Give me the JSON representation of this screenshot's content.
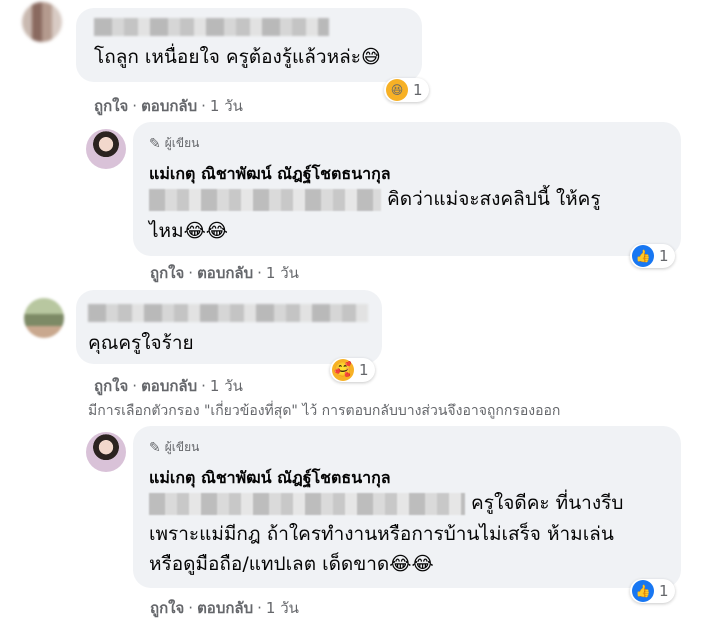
{
  "comments": [
    {
      "text": "โถลูก เหนื่อยใจ ครูต้องรู้แล้วหล่ะ",
      "emoji": "😅",
      "reaction": {
        "icon": "haha-reaction-icon",
        "glyph": "😆",
        "count": "1"
      },
      "like": "ถูกใจ",
      "reply": "ตอบกลับ",
      "time": "1 วัน"
    },
    {
      "author_badge": "ผู้เขียน",
      "author_name": "แม่เกตุ ณิชาพัฒน์ ณัฎฐ์โชตธนากุล",
      "text_line1": "คิดว่าแม่จะสงคลิปนี้ ให้ครู",
      "text_line2": "ไหม",
      "emoji": "😂😂",
      "reaction": {
        "icon": "like-reaction-icon",
        "glyph": "👍",
        "count": "1"
      },
      "like": "ถูกใจ",
      "reply": "ตอบกลับ",
      "time": "1 วัน"
    },
    {
      "text": "คุณครูใจร้าย",
      "reaction": {
        "icon": "care-reaction-icon",
        "glyph": "🥰",
        "count": "1"
      },
      "like": "ถูกใจ",
      "reply": "ตอบกลับ",
      "time": "1 วัน"
    },
    {
      "author_badge": "ผู้เขียน",
      "author_name": "แม่เกตุ ณิชาพัฒน์ ณัฎฐ์โชตธนากุล",
      "text_line1": "ครูใจดีคะ ที่นางรีบ",
      "text_line2": "เพราะแม่มีกฎ ถ้าใครทำงานหรือการบ้านไม่เสร็จ ห้ามเล่น",
      "text_line3": "หรือดูมือถือ/แทปเลต เด็ดขาด",
      "emoji": "😂😂",
      "reaction": {
        "icon": "like-reaction-icon",
        "glyph": "👍",
        "count": "1"
      },
      "like": "ถูกใจ",
      "reply": "ตอบกลับ",
      "time": "1 วัน"
    }
  ],
  "filter_note": "มีการเลือกตัวกรอง \"เกี่ยวข้องที่สุด\" ไว้ การตอบกลับบางส่วนจึงอาจถูกกรองออก",
  "dot": "·",
  "pen_icon": "✎"
}
